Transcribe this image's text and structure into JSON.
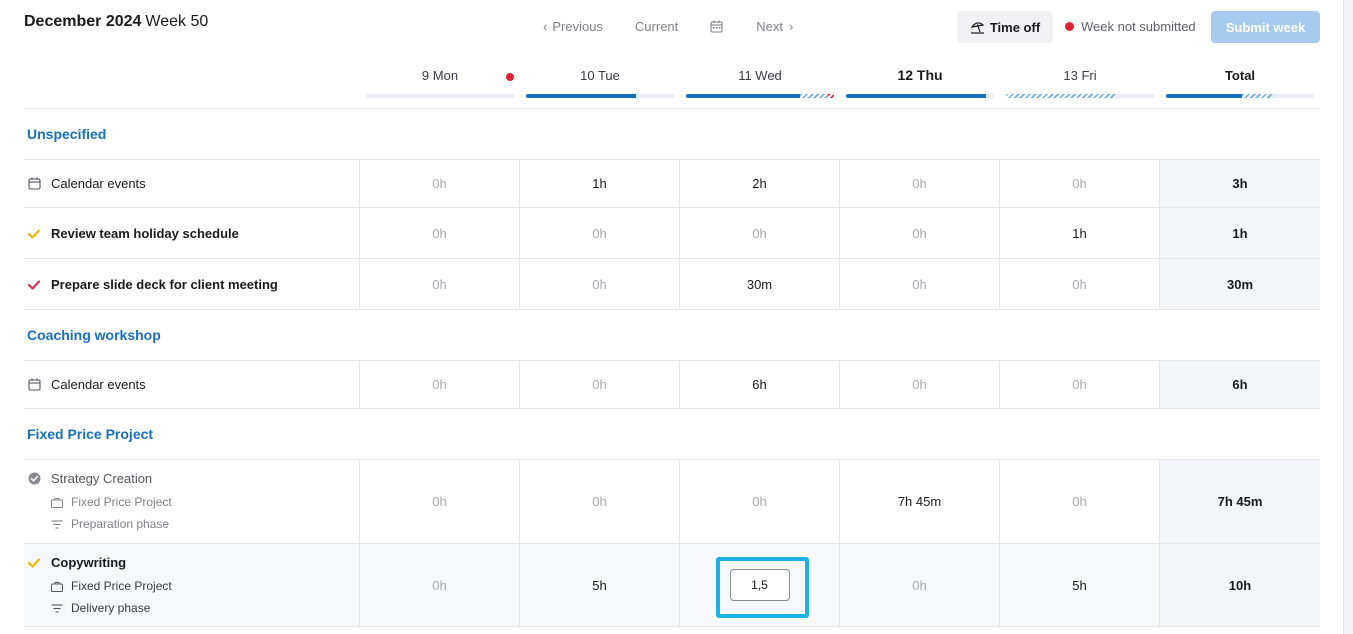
{
  "header": {
    "month": "December 2024",
    "week": "Week 50",
    "previous_label": "Previous",
    "current_label": "Current",
    "next_label": "Next",
    "time_off_label": "Time off",
    "status_label": "Week not submitted",
    "submit_label": "Submit week"
  },
  "days": [
    "9 Mon",
    "10 Tue",
    "11 Wed",
    "12 Thu",
    "13 Fri",
    "Total"
  ],
  "sections": {
    "unspecified": {
      "title": "Unspecified",
      "rows": [
        {
          "name": "Calendar events",
          "values": [
            "0h",
            "1h",
            "2h",
            "0h",
            "0h"
          ],
          "total": "3h"
        },
        {
          "name": "Review team holiday schedule",
          "values": [
            "0h",
            "0h",
            "0h",
            "0h",
            "1h"
          ],
          "total": "1h"
        },
        {
          "name": "Prepare slide deck for client meeting",
          "values": [
            "0h",
            "0h",
            "30m",
            "0h",
            "0h"
          ],
          "total": "30m"
        }
      ]
    },
    "coaching": {
      "title": "Coaching workshop",
      "rows": [
        {
          "name": "Calendar events",
          "values": [
            "0h",
            "0h",
            "6h",
            "0h",
            "0h"
          ],
          "total": "6h"
        }
      ]
    },
    "fixed": {
      "title": "Fixed Price Project",
      "rows": [
        {
          "name": "Strategy Creation",
          "project": "Fixed Price Project",
          "phase": "Preparation phase",
          "values": [
            "0h",
            "0h",
            "0h",
            "7h 45m",
            "0h"
          ],
          "total": "7h 45m"
        },
        {
          "name": "Copywriting",
          "project": "Fixed Price Project",
          "phase": "Delivery phase",
          "values": [
            "0h",
            "5h",
            "1,5",
            "0h",
            "5h"
          ],
          "total": "10h"
        }
      ]
    }
  },
  "colors": {
    "accent": "#1670c2",
    "error": "#e0242f",
    "check_yellow": "#f2b705",
    "check_red": "#d1344b",
    "focus": "#1ab2e8"
  }
}
